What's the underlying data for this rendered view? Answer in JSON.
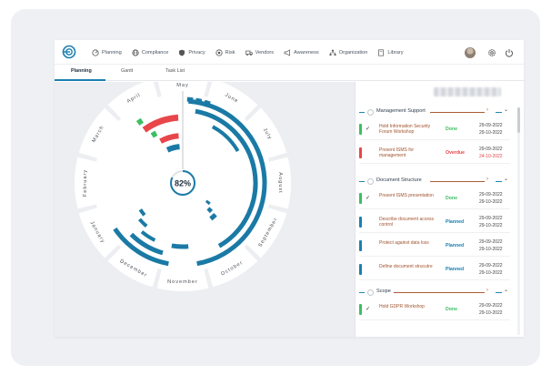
{
  "colors": {
    "accent": "#1b7fb0",
    "ring": "#1a7aa5",
    "overdue": "#e8464a",
    "done": "#3cbf63",
    "text_brown": "#a0522d"
  },
  "nav": {
    "items": [
      {
        "label": "Planning",
        "icon": "gauge-icon"
      },
      {
        "label": "Compliance",
        "icon": "globe-icon"
      },
      {
        "label": "Privacy",
        "icon": "shield-icon"
      },
      {
        "label": "Risk",
        "icon": "target-icon"
      },
      {
        "label": "Vendors",
        "icon": "truck-icon"
      },
      {
        "label": "Awareness",
        "icon": "megaphone-icon"
      },
      {
        "label": "Organization",
        "icon": "org-chart-icon"
      },
      {
        "label": "Library",
        "icon": "book-icon"
      }
    ]
  },
  "tabs": [
    "Planning",
    "Gantt",
    "Task List"
  ],
  "wheel": {
    "progress_label": "82%",
    "progress": 0.82,
    "months": [
      "May",
      "June",
      "July",
      "August",
      "September",
      "October",
      "November",
      "December",
      "January",
      "February",
      "March",
      "April"
    ]
  },
  "panel": {
    "groups": [
      {
        "title": "Management Support",
        "rows": [
          {
            "check": "✓",
            "title": "Hold Information Security Forum Workshop",
            "status": "Done",
            "date1": "29-09-2022",
            "date2": "29-10-2022",
            "date2_overdue": false,
            "kind": "done"
          },
          {
            "check": "",
            "title": "Present ISMS for management",
            "status": "Overdue",
            "date1": "29-09-2022",
            "date2": "24-10-2022",
            "date2_overdue": true,
            "kind": "overdue"
          }
        ]
      },
      {
        "title": "Document Structure",
        "rows": [
          {
            "check": "✓",
            "title": "Present ISMS presentation",
            "status": "Done",
            "date1": "29-09-2022",
            "date2": "29-10-2022",
            "date2_overdue": false,
            "kind": "done"
          },
          {
            "check": "",
            "title": "Describe document access control",
            "status": "Planned",
            "date1": "29-09-2022",
            "date2": "29-10-2022",
            "date2_overdue": false,
            "kind": "planned"
          },
          {
            "check": "",
            "title": "Protect against data loss",
            "status": "Planned",
            "date1": "29-09-2022",
            "date2": "29-10-2022",
            "date2_overdue": false,
            "kind": "planned"
          },
          {
            "check": "",
            "title": "Define document strucutre",
            "status": "Planned",
            "date1": "29-09-2022",
            "date2": "29-10-2022",
            "date2_overdue": false,
            "kind": "planned"
          }
        ]
      },
      {
        "title": "Scope",
        "rows": [
          {
            "check": "✓",
            "title": "Hold GDPR Workshop",
            "status": "Done",
            "date1": "29-09-2022",
            "date2": "29-10-2022",
            "date2_overdue": false,
            "kind": "done"
          }
        ]
      }
    ]
  }
}
